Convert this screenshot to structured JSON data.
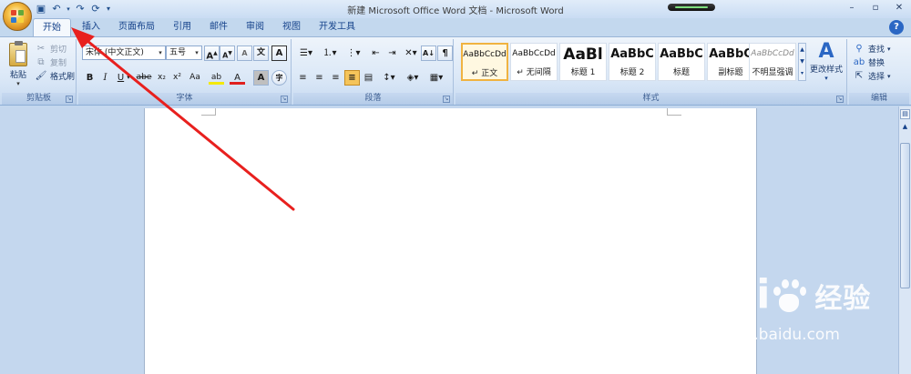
{
  "window": {
    "title": "新建 Microsoft Office Word 文档 - Microsoft Word",
    "controls": [
      "–",
      "▫",
      "✕"
    ]
  },
  "qat_icons": [
    "save-icon",
    "undo-icon",
    "redo-icon",
    "repeat-icon",
    "customize-icon"
  ],
  "tabs": [
    "开始",
    "插入",
    "页面布局",
    "引用",
    "邮件",
    "审阅",
    "视图",
    "开发工具"
  ],
  "active_tab": "开始",
  "clipboard": {
    "group_label": "剪贴板",
    "paste": "粘贴",
    "cut": "剪切",
    "copy": "复制",
    "format_painter": "格式刷"
  },
  "font": {
    "group_label": "字体",
    "font_name": "宋体 (中文正文)",
    "font_size": "五号",
    "bold": "B",
    "italic": "I",
    "underline": "U",
    "strike": "abe",
    "subscript": "x₂",
    "superscript": "x²",
    "change_case": "Aa",
    "grow": "A",
    "shrink": "A",
    "clear": "A",
    "phonetic": "文",
    "border_char": "A",
    "font_color_a": "A",
    "highlight": "ab",
    "char_shade": "A",
    "enclose": "字"
  },
  "paragraph": {
    "group_label": "段落"
  },
  "styles": {
    "group_label": "样式",
    "items": [
      {
        "sample": "AaBbCcDd",
        "name": "↵ 正文"
      },
      {
        "sample": "AaBbCcDd",
        "name": "↵ 无间隔"
      },
      {
        "sample": "AaBl",
        "name": "标题 1"
      },
      {
        "sample": "AaBbC",
        "name": "标题 2"
      },
      {
        "sample": "AaBbC",
        "name": "标题"
      },
      {
        "sample": "AaBbC",
        "name": "副标题"
      },
      {
        "sample": "AaBbCcDd",
        "name": "不明显强调"
      }
    ],
    "change_styles": "更改样式"
  },
  "editing": {
    "group_label": "编辑",
    "find": "查找",
    "replace": "替换",
    "select": "选择"
  },
  "watermark": {
    "logo_left": "Bai",
    "logo_right": "经验",
    "url": "jingyan.baidu.com"
  },
  "colors": {
    "accent": "#15428b",
    "annotation_arrow": "#e8201e",
    "selected_style": "#f0b341"
  }
}
